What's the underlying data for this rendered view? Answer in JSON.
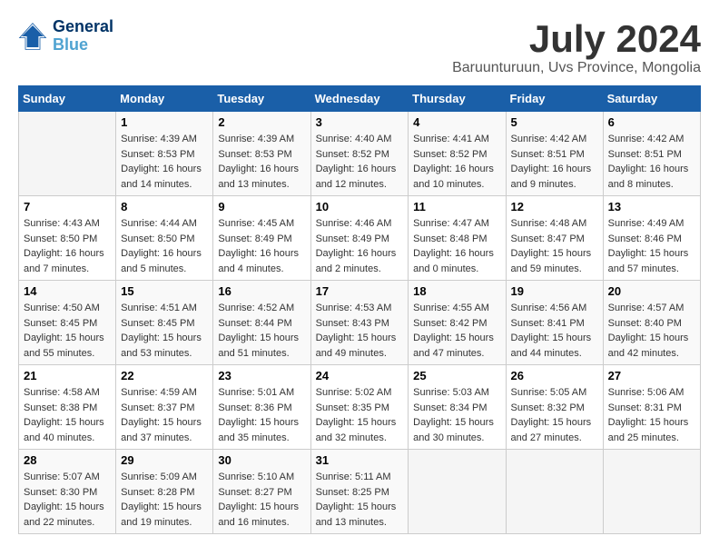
{
  "header": {
    "logo_line1": "General",
    "logo_line2": "Blue",
    "month": "July 2024",
    "location": "Baruunturuun, Uvs Province, Mongolia"
  },
  "weekdays": [
    "Sunday",
    "Monday",
    "Tuesday",
    "Wednesday",
    "Thursday",
    "Friday",
    "Saturday"
  ],
  "weeks": [
    [
      {
        "day": "",
        "info": ""
      },
      {
        "day": "1",
        "info": "Sunrise: 4:39 AM\nSunset: 8:53 PM\nDaylight: 16 hours\nand 14 minutes."
      },
      {
        "day": "2",
        "info": "Sunrise: 4:39 AM\nSunset: 8:53 PM\nDaylight: 16 hours\nand 13 minutes."
      },
      {
        "day": "3",
        "info": "Sunrise: 4:40 AM\nSunset: 8:52 PM\nDaylight: 16 hours\nand 12 minutes."
      },
      {
        "day": "4",
        "info": "Sunrise: 4:41 AM\nSunset: 8:52 PM\nDaylight: 16 hours\nand 10 minutes."
      },
      {
        "day": "5",
        "info": "Sunrise: 4:42 AM\nSunset: 8:51 PM\nDaylight: 16 hours\nand 9 minutes."
      },
      {
        "day": "6",
        "info": "Sunrise: 4:42 AM\nSunset: 8:51 PM\nDaylight: 16 hours\nand 8 minutes."
      }
    ],
    [
      {
        "day": "7",
        "info": "Sunrise: 4:43 AM\nSunset: 8:50 PM\nDaylight: 16 hours\nand 7 minutes."
      },
      {
        "day": "8",
        "info": "Sunrise: 4:44 AM\nSunset: 8:50 PM\nDaylight: 16 hours\nand 5 minutes."
      },
      {
        "day": "9",
        "info": "Sunrise: 4:45 AM\nSunset: 8:49 PM\nDaylight: 16 hours\nand 4 minutes."
      },
      {
        "day": "10",
        "info": "Sunrise: 4:46 AM\nSunset: 8:49 PM\nDaylight: 16 hours\nand 2 minutes."
      },
      {
        "day": "11",
        "info": "Sunrise: 4:47 AM\nSunset: 8:48 PM\nDaylight: 16 hours\nand 0 minutes."
      },
      {
        "day": "12",
        "info": "Sunrise: 4:48 AM\nSunset: 8:47 PM\nDaylight: 15 hours\nand 59 minutes."
      },
      {
        "day": "13",
        "info": "Sunrise: 4:49 AM\nSunset: 8:46 PM\nDaylight: 15 hours\nand 57 minutes."
      }
    ],
    [
      {
        "day": "14",
        "info": "Sunrise: 4:50 AM\nSunset: 8:45 PM\nDaylight: 15 hours\nand 55 minutes."
      },
      {
        "day": "15",
        "info": "Sunrise: 4:51 AM\nSunset: 8:45 PM\nDaylight: 15 hours\nand 53 minutes."
      },
      {
        "day": "16",
        "info": "Sunrise: 4:52 AM\nSunset: 8:44 PM\nDaylight: 15 hours\nand 51 minutes."
      },
      {
        "day": "17",
        "info": "Sunrise: 4:53 AM\nSunset: 8:43 PM\nDaylight: 15 hours\nand 49 minutes."
      },
      {
        "day": "18",
        "info": "Sunrise: 4:55 AM\nSunset: 8:42 PM\nDaylight: 15 hours\nand 47 minutes."
      },
      {
        "day": "19",
        "info": "Sunrise: 4:56 AM\nSunset: 8:41 PM\nDaylight: 15 hours\nand 44 minutes."
      },
      {
        "day": "20",
        "info": "Sunrise: 4:57 AM\nSunset: 8:40 PM\nDaylight: 15 hours\nand 42 minutes."
      }
    ],
    [
      {
        "day": "21",
        "info": "Sunrise: 4:58 AM\nSunset: 8:38 PM\nDaylight: 15 hours\nand 40 minutes."
      },
      {
        "day": "22",
        "info": "Sunrise: 4:59 AM\nSunset: 8:37 PM\nDaylight: 15 hours\nand 37 minutes."
      },
      {
        "day": "23",
        "info": "Sunrise: 5:01 AM\nSunset: 8:36 PM\nDaylight: 15 hours\nand 35 minutes."
      },
      {
        "day": "24",
        "info": "Sunrise: 5:02 AM\nSunset: 8:35 PM\nDaylight: 15 hours\nand 32 minutes."
      },
      {
        "day": "25",
        "info": "Sunrise: 5:03 AM\nSunset: 8:34 PM\nDaylight: 15 hours\nand 30 minutes."
      },
      {
        "day": "26",
        "info": "Sunrise: 5:05 AM\nSunset: 8:32 PM\nDaylight: 15 hours\nand 27 minutes."
      },
      {
        "day": "27",
        "info": "Sunrise: 5:06 AM\nSunset: 8:31 PM\nDaylight: 15 hours\nand 25 minutes."
      }
    ],
    [
      {
        "day": "28",
        "info": "Sunrise: 5:07 AM\nSunset: 8:30 PM\nDaylight: 15 hours\nand 22 minutes."
      },
      {
        "day": "29",
        "info": "Sunrise: 5:09 AM\nSunset: 8:28 PM\nDaylight: 15 hours\nand 19 minutes."
      },
      {
        "day": "30",
        "info": "Sunrise: 5:10 AM\nSunset: 8:27 PM\nDaylight: 15 hours\nand 16 minutes."
      },
      {
        "day": "31",
        "info": "Sunrise: 5:11 AM\nSunset: 8:25 PM\nDaylight: 15 hours\nand 13 minutes."
      },
      {
        "day": "",
        "info": ""
      },
      {
        "day": "",
        "info": ""
      },
      {
        "day": "",
        "info": ""
      }
    ]
  ]
}
